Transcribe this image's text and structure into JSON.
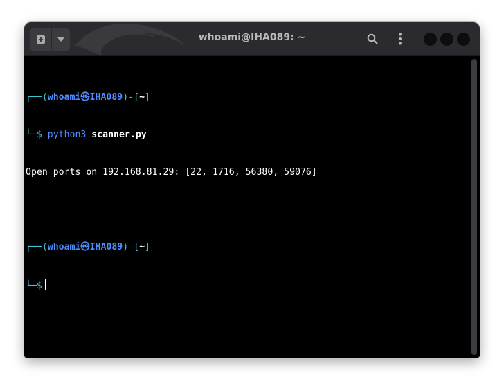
{
  "window": {
    "title": "whoami@IHA089: ~"
  },
  "toolbar": {
    "new_tab_icon": "new-tab-icon",
    "menu_icon": "chevron-down-icon",
    "search_icon": "search-icon",
    "kebab_icon": "kebab-menu-icon"
  },
  "terminal": {
    "prompt1": {
      "frame_open": "┌──(",
      "user": "whoami",
      "at": "㉿",
      "host": "IHA089",
      "frame_mid": ")-[",
      "dir": "~",
      "frame_close": "]",
      "frame_bottom": "└─$ ",
      "command": "python3",
      "argument": "scanner.py"
    },
    "output": "Open ports on 192.168.81.29: [22, 1716, 56380, 59076]",
    "prompt2": {
      "frame_open": "┌──(",
      "user": "whoami",
      "at": "㉿",
      "host": "IHA089",
      "frame_mid": ")-[",
      "dir": "~",
      "frame_close": "]",
      "frame_bottom": "└─$"
    }
  },
  "colors": {
    "titlebar": "#2b2b2f",
    "terminal_bg": "#000000",
    "prompt_frame": "#3cc4d8",
    "prompt_user": "#4f8cff",
    "text": "#ffffff"
  }
}
